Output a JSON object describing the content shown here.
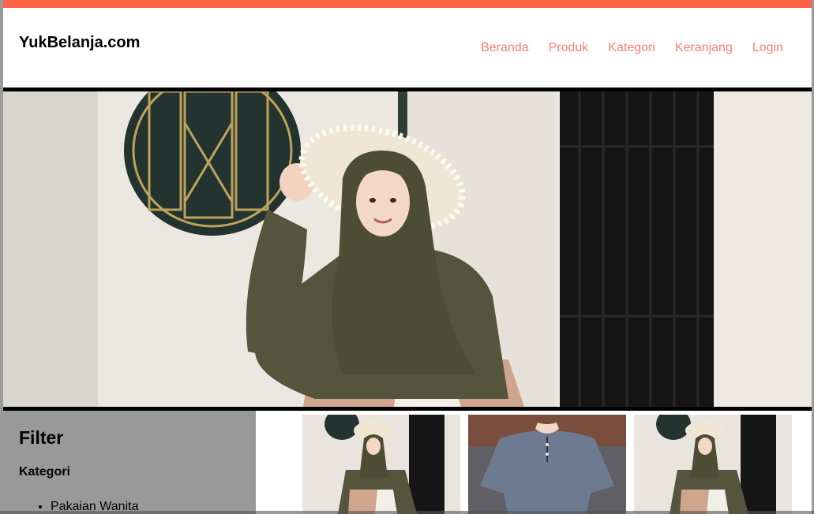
{
  "brand": "YukBelanja.com",
  "nav": [
    {
      "label": "Beranda"
    },
    {
      "label": "Produk"
    },
    {
      "label": "Kategori"
    },
    {
      "label": "Keranjang"
    },
    {
      "label": "Login"
    }
  ],
  "colors": {
    "topbar": "#ff6347",
    "nav_link": "#fa8072",
    "sidebar_bg": "#999999"
  },
  "hero": {
    "image_name": "hijab-woman-hat-photo"
  },
  "filter": {
    "title": "Filter",
    "category_heading": "Kategori",
    "items": [
      "Pakaian Wanita"
    ]
  },
  "products": [
    {
      "image_name": "hijab-woman-photo"
    },
    {
      "image_name": "man-grey-shirt-photo"
    },
    {
      "image_name": "hijab-woman-photo"
    }
  ]
}
